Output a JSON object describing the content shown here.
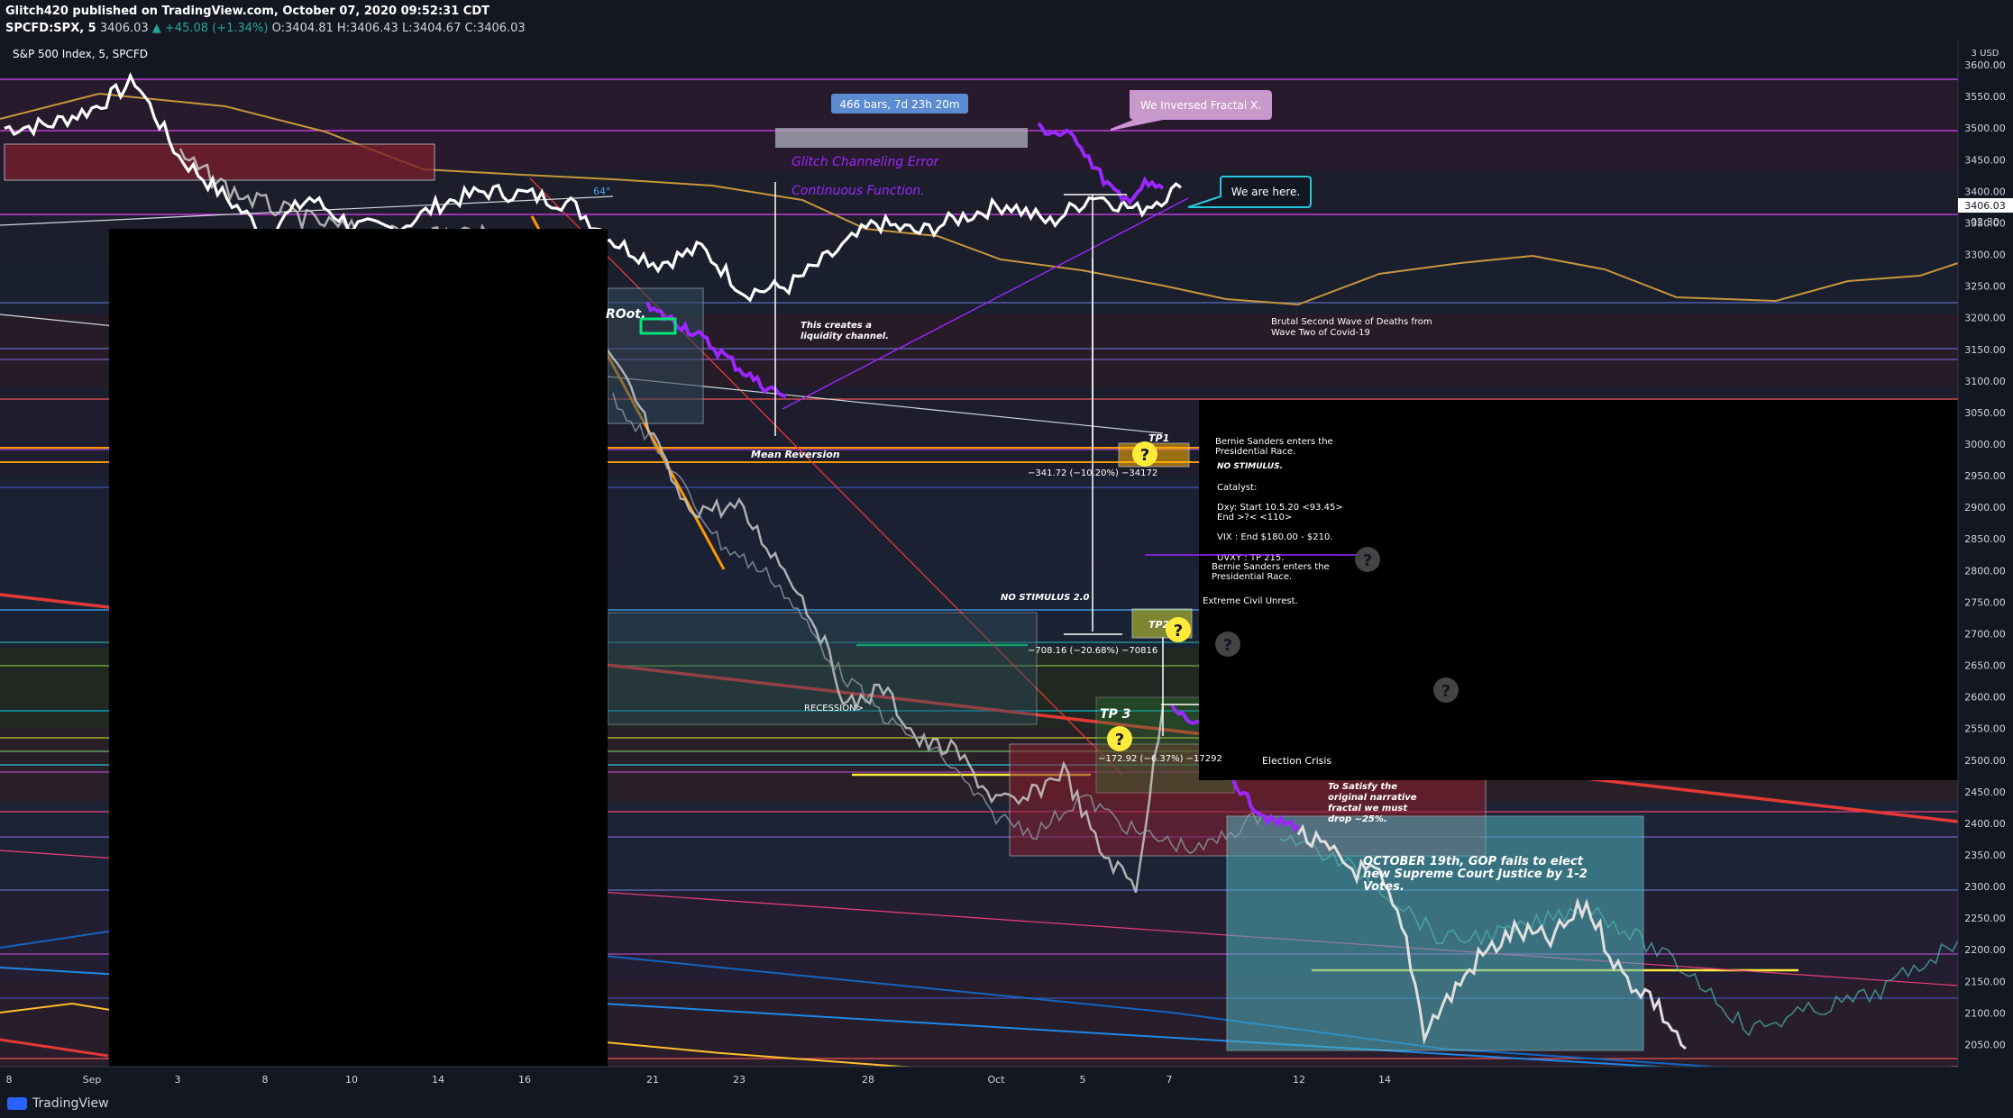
{
  "header": {
    "publisher_line": "Glitch420 published on TradingView.com, October 07, 2020 09:52:31 CDT",
    "symbol": "SPCFD:SPX, 5",
    "last": "3406.03",
    "change": "▲ +45.08 (+1.34%)",
    "ohlc": "O:3404.81 H:3406.43 L:3404.67 C:3406.03",
    "legend": "S&P 500 Index, 5, SPCFD"
  },
  "footer": {
    "brand": "TradingView"
  },
  "colors": {
    "background": "#131722",
    "price_line": "#ffffff",
    "projection": "#9c27ff",
    "fractal_ghost": "#c8c8c8",
    "ma_line": "#c8963c",
    "trend_red": "#e53935",
    "orange": "#ff9800",
    "yellow": "#ffeb3b",
    "teal_box": "#4fb3bf"
  },
  "chart_data": {
    "type": "line",
    "title": "S&P 500 Index, 5, SPCFD",
    "currency": "3 USD",
    "ylim": [
      2015,
      3640
    ],
    "yticks": [
      3600,
      3550,
      3500,
      3450,
      3400,
      3350,
      3300,
      3250,
      3200,
      3150,
      3100,
      3050,
      3000,
      2950,
      2900,
      2850,
      2800,
      2750,
      2700,
      2650,
      2600,
      2550,
      2500,
      2450,
      2400,
      2350,
      2300,
      2250,
      2200,
      2150,
      2100,
      2050
    ],
    "x_tick_labels": [
      "8",
      "Sep",
      "3",
      "8",
      "10",
      "14",
      "16",
      "21",
      "23",
      "28",
      "Oct",
      "5",
      "7",
      "12",
      "14"
    ],
    "last_price_label": "3406.03",
    "countdown_label": "02:30",
    "series": [
      {
        "name": "SPX",
        "x": [
          "Aug 28",
          "Aug 31",
          "Sep 1",
          "Sep 2",
          "Sep 3",
          "Sep 4",
          "Sep 8",
          "Sep 9",
          "Sep 10",
          "Sep 11",
          "Sep 14",
          "Sep 15",
          "Sep 16",
          "Sep 17",
          "Sep 18",
          "Sep 21",
          "Sep 22",
          "Sep 23",
          "Sep 24",
          "Sep 25",
          "Sep 28",
          "Sep 29",
          "Sep 30",
          "Oct 1",
          "Oct 2",
          "Oct 5",
          "Oct 6",
          "Oct 7"
        ],
        "values": [
          3500,
          3505,
          3530,
          3575,
          3455,
          3395,
          3335,
          3390,
          3345,
          3340,
          3380,
          3400,
          3395,
          3380,
          3320,
          3285,
          3310,
          3240,
          3250,
          3300,
          3350,
          3335,
          3360,
          3380,
          3350,
          3395,
          3370,
          3406
        ]
      }
    ],
    "annotations": {
      "bars_range": "466 bars, 7d 23h 20m",
      "bubble_fractal": "We Inversed Fractal X.",
      "bubble_here": "We are here.",
      "glitch1": "Glitch Channeling Error",
      "glitch2": "Continuous Function.",
      "fib_64": "64°",
      "root": "ROot.",
      "liquidity1": "This creates a",
      "liquidity2": "liquidity channel.",
      "mean_reversion": "Mean Reversion",
      "tp1": "TP1",
      "tp1_measure": "−341.72 (−10.20%) −34172",
      "no_stimulus_2": "NO STIMULUS 2.0",
      "tp2": "TP2",
      "tp2_measure": "−708.16 (−20.68%) −70816",
      "recession": "RECESSION>",
      "tp3": "TP 3",
      "tp3_measure": "−172.92 (−6.37%) −17292",
      "election": "Election Crisis",
      "satisfy1": "To Satisfy the",
      "satisfy2": "original narrative",
      "satisfy3": "fractal we must",
      "satisfy4": "drop ~25%.",
      "october1": "OCTOBER 19th, GOP fails to elect",
      "october2": "new Supreme Court Justice by 1-2",
      "october3": "Votes.",
      "wave1": "Brutal Second Wave of Deaths from",
      "wave2": "Wave Two of Covid-19",
      "bernie1": "Bernie Sanders enters the",
      "bernie2": "Presidential Race.",
      "no_stimulus": "NO STIMULUS.",
      "catalyst": "Catalyst:",
      "dxy1": "Dxy: Start 10.5.20 <93.45>",
      "dxy2": "End >?< <110>",
      "vix": "VIX : End $180.00 - $210.",
      "uvxy": "UVXY : TP 215.",
      "bernie3": "Bernie Sanders enters the",
      "bernie4": "Presidential Race.",
      "unrest": "Extreme Civil Unrest.",
      "question": "?"
    }
  }
}
